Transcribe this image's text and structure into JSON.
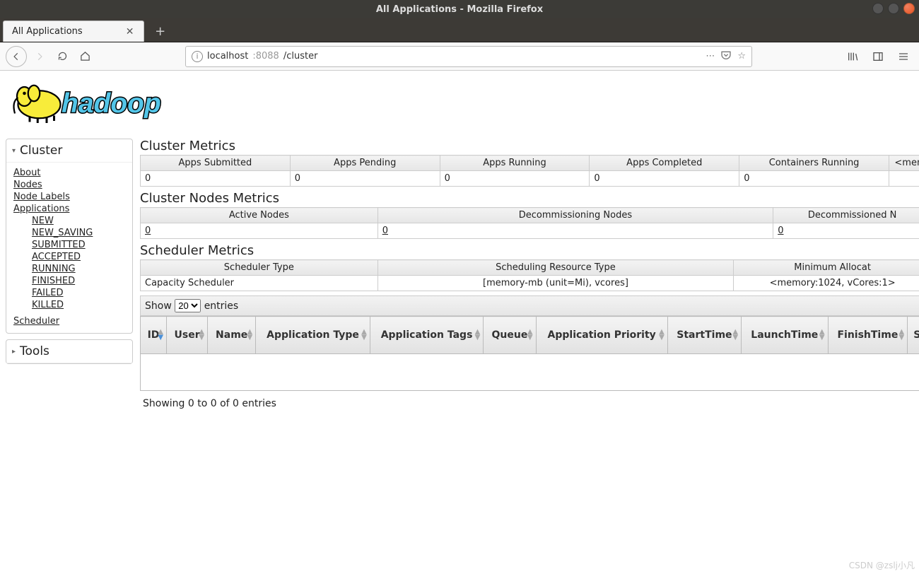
{
  "window_title": "All Applications - Mozilla Firefox",
  "tab_title": "All Applications",
  "url": {
    "host": "localhost",
    "port": ":8088",
    "path": "/cluster"
  },
  "logo_text": "hadoop",
  "sidebar": {
    "cluster_title": "Cluster",
    "about": "About",
    "nodes": "Nodes",
    "nodelabels": "Node Labels",
    "applications": "Applications",
    "states": {
      "new": "NEW",
      "new_saving": "NEW_SAVING",
      "submitted": "SUBMITTED",
      "accepted": "ACCEPTED",
      "running": "RUNNING",
      "finished": "FINISHED",
      "failed": "FAILED",
      "killed": "KILLED"
    },
    "scheduler": "Scheduler",
    "tools_title": "Tools"
  },
  "sections": {
    "cluster_metrics": "Cluster Metrics",
    "cluster_nodes": "Cluster Nodes Metrics",
    "scheduler_metrics": "Scheduler Metrics"
  },
  "cluster_metrics": {
    "headers": {
      "apps_submitted": "Apps Submitted",
      "apps_pending": "Apps Pending",
      "apps_running": "Apps Running",
      "apps_completed": "Apps Completed",
      "containers_running": "Containers Running",
      "more": "<mem"
    },
    "values": {
      "apps_submitted": "0",
      "apps_pending": "0",
      "apps_running": "0",
      "apps_completed": "0",
      "containers_running": "0"
    }
  },
  "cluster_nodes": {
    "headers": {
      "active": "Active Nodes",
      "decommissioning": "Decommissioning Nodes",
      "decommissioned": "Decommissioned N"
    },
    "values": {
      "active": "0",
      "decommissioning": "0",
      "decommissioned": "0"
    }
  },
  "scheduler": {
    "headers": {
      "type": "Scheduler Type",
      "resource": "Scheduling Resource Type",
      "min_alloc": "Minimum Allocat"
    },
    "values": {
      "type": "Capacity Scheduler",
      "resource": "[memory-mb (unit=Mi), vcores]",
      "min_alloc": "<memory:1024, vCores:1>"
    }
  },
  "dt": {
    "show": "Show",
    "entries": "entries",
    "selected_len": "20",
    "info": "Showing 0 to 0 of 0 entries",
    "cols": {
      "id": "ID",
      "user": "User",
      "name": "Name",
      "apptype": "Application Type",
      "apptags": "Application Tags",
      "queue": "Queue",
      "apppri": "Application Priority",
      "start": "StartTime",
      "launch": "LaunchTime",
      "finish": "FinishTime",
      "status": "St"
    }
  },
  "watermark": "CSDN @zslj小凡"
}
